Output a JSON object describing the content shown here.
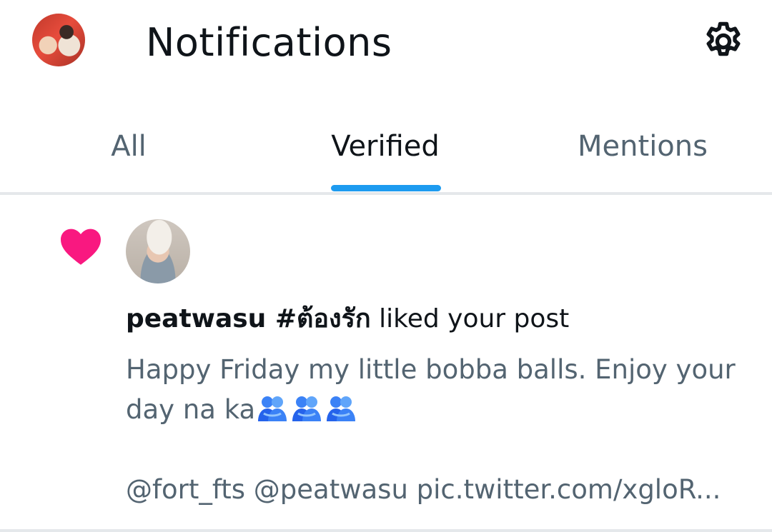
{
  "header": {
    "title": "Notifications",
    "settings_icon": "gear-icon"
  },
  "tabs": [
    {
      "label": "All",
      "active": false
    },
    {
      "label": "Verified",
      "active": true
    },
    {
      "label": "Mentions",
      "active": false
    }
  ],
  "notification": {
    "icon": "heart-icon",
    "user_name": "peatwasu #ต้องรัก",
    "action": " liked your post",
    "post_text_line": "Happy Friday my little bobba balls. Enjoy your day na ka",
    "emoji": "people-hugging-icon",
    "emoji_count": 3,
    "post_text_mentions": "@fort_fts @peatwasu pic.twitter.com/xgloR..."
  },
  "colors": {
    "accent": "#1d9bf0",
    "heart": "#f91880",
    "text_primary": "#0f1419",
    "text_secondary": "#536471"
  }
}
